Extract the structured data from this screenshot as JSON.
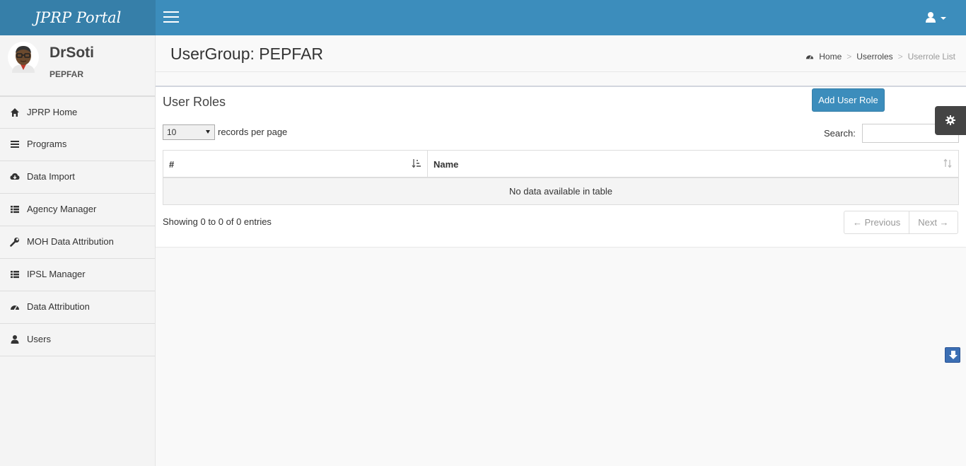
{
  "app": {
    "logo_text": "JPRP Portal",
    "accent_color": "#3c8dbc"
  },
  "user": {
    "name": "DrSoti",
    "group": "PEPFAR"
  },
  "sidebar": {
    "items": [
      {
        "label": "JPRP Home",
        "icon": "home-icon"
      },
      {
        "label": "Programs",
        "icon": "bars-icon"
      },
      {
        "label": "Data Import",
        "icon": "cloud-download-icon"
      },
      {
        "label": "Agency Manager",
        "icon": "list-icon"
      },
      {
        "label": "MOH Data Attribution",
        "icon": "wrench-icon"
      },
      {
        "label": "IPSL Manager",
        "icon": "list-icon"
      },
      {
        "label": "Data Attribution",
        "icon": "dashboard-icon"
      },
      {
        "label": "Users",
        "icon": "user-icon"
      }
    ]
  },
  "header": {
    "title": "UserGroup: PEPFAR",
    "breadcrumb": {
      "home": "Home",
      "section": "Userroles",
      "current": "Userrole List"
    }
  },
  "box": {
    "title": "User Roles",
    "add_button": "Add User Role",
    "page_length": "10",
    "length_label": "records per page",
    "search_label": "Search:",
    "columns": [
      "#",
      "Name"
    ],
    "empty_message": "No data available in table",
    "info": "Showing 0 to 0 of 0 entries",
    "prev": "← Previous",
    "next": "Next →"
  }
}
